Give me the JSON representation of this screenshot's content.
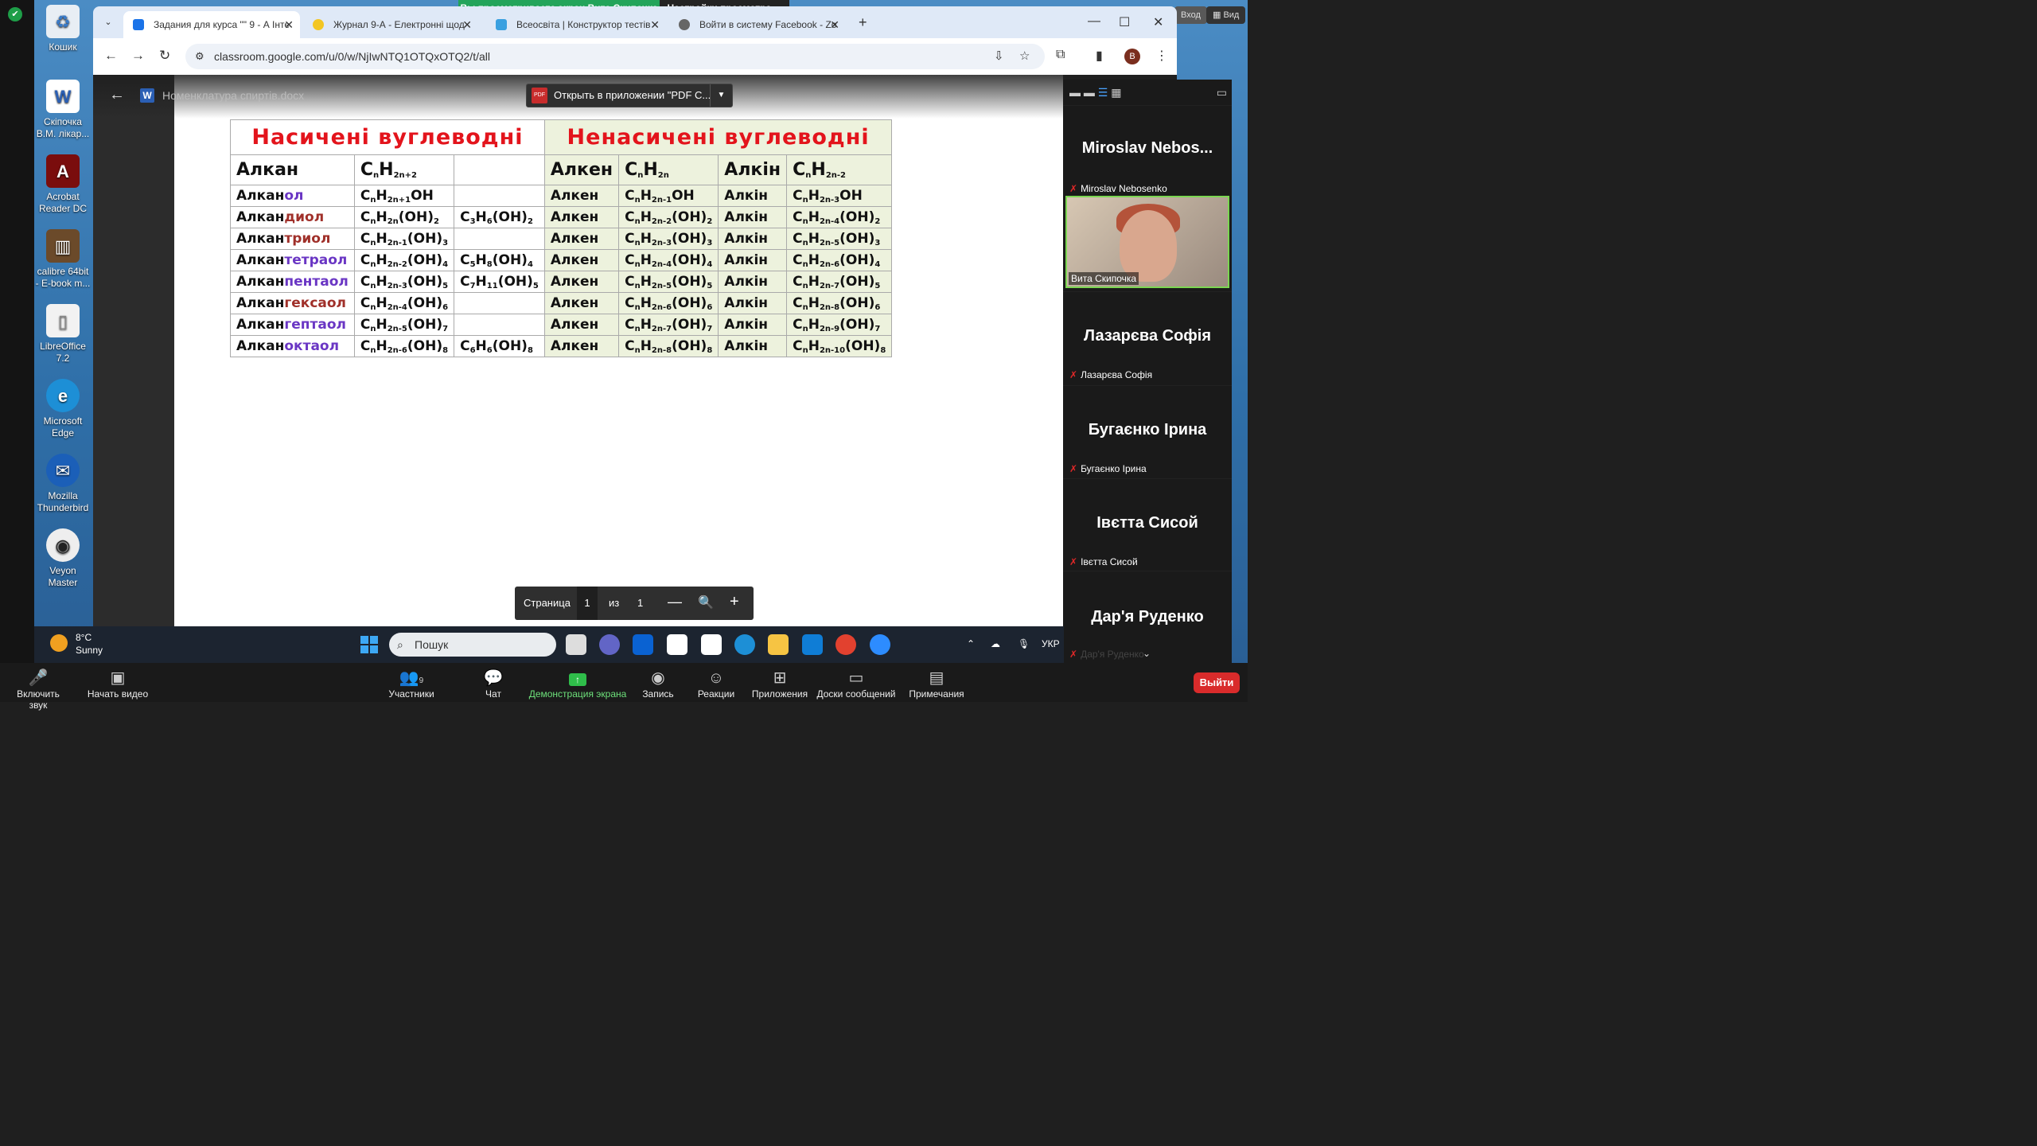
{
  "share_banner": {
    "viewing": "Вы просматриваете экран Вита Скипочка",
    "settings": "Настройки просмотра"
  },
  "top_right": {
    "login": "Вход",
    "view": "Вид"
  },
  "desktop_icons": [
    {
      "label": "Кошик",
      "icon": "recycle-bin-icon"
    },
    {
      "label": "Скіпочка В.М. лікар...",
      "icon": "word-icon"
    },
    {
      "label": "Acrobat Reader DC",
      "icon": "acrobat-icon"
    },
    {
      "label": "calibre 64bit - E-book m...",
      "icon": "calibre-icon"
    },
    {
      "label": "LibreOffice 7.2",
      "icon": "libreoffice-icon"
    },
    {
      "label": "Microsoft Edge",
      "icon": "edge-icon"
    },
    {
      "label": "Mozilla Thunderbird",
      "icon": "thunderbird-icon"
    },
    {
      "label": "Veyon Master",
      "icon": "veyon-icon"
    }
  ],
  "browser": {
    "tabs": [
      {
        "title": "Задания для курса \"\" 9 - А Інте",
        "active": true
      },
      {
        "title": "Журнал 9-А - Електронні щод"
      },
      {
        "title": "Всеосвіта | Конструктор тестів"
      },
      {
        "title": "Войти в систему Facebook - Zo"
      }
    ],
    "url": "classroom.google.com/u/0/w/NjIwNTQ1OTQxOTQ2/t/all",
    "profile_initial": "B"
  },
  "pdf": {
    "doc_name": "Номенклатура спиртів.docx",
    "open_in": "Открыть в приложении \"PDF C...",
    "page_label": "Страница",
    "page_current": "1",
    "page_of": "из",
    "page_total": "1"
  },
  "table": {
    "header_left": "Насичені вуглеводні",
    "header_right": "Ненасичені вуглеводні",
    "sub_alkan": "Алкан",
    "sub_alken": "Алкен",
    "sub_alkin": "Алкін",
    "rows": [
      {
        "base": "Алкан",
        "suffix": "ол",
        "alken": "Алкен",
        "alkin": "Алкін"
      },
      {
        "base": "Алкан",
        "suffix": "диол",
        "example": "C3H6(OH)2"
      },
      {
        "base": "Алкан",
        "suffix": "триол"
      },
      {
        "base": "Алкан",
        "suffix": "тетраол",
        "example": "C5H8(OH)4"
      },
      {
        "base": "Алкан",
        "suffix": "пентаол",
        "example": "C7H11(OH)5"
      },
      {
        "base": "Алкан",
        "suffix": "гексаол"
      },
      {
        "base": "Алкан",
        "suffix": "гептаол"
      },
      {
        "base": "Алкан",
        "suffix": "октаол",
        "example": "C6H6(OH)8"
      }
    ]
  },
  "participants": [
    {
      "big": "Miroslav  Nebos...",
      "small": "Miroslav Nebosenko"
    },
    {
      "small": "Вита Скипочка"
    },
    {
      "big": "Лазарєва Софія",
      "small": "Лазарєва Софія"
    },
    {
      "big": "Бугаєнко Ірина",
      "small": "Бугаєнко Ірина"
    },
    {
      "big": "Івєтта Сисой",
      "small": "Івєтта Сисой"
    },
    {
      "big": "Дар'я Руденко",
      "small": "Дар'я Руденко"
    }
  ],
  "taskbar": {
    "temp": "8°C",
    "weather": "Sunny",
    "search": "Пошук",
    "lang": "УКР"
  },
  "zoom": {
    "mic": "Включить звук",
    "video": "Начать видео",
    "participants": "Участники",
    "participants_count": "9",
    "chat": "Чат",
    "share": "Демонстрация экрана",
    "record": "Запись",
    "reactions": "Реакции",
    "apps": "Приложения",
    "whiteboards": "Доски сообщений",
    "notes": "Примечания",
    "exit": "Выйти"
  }
}
